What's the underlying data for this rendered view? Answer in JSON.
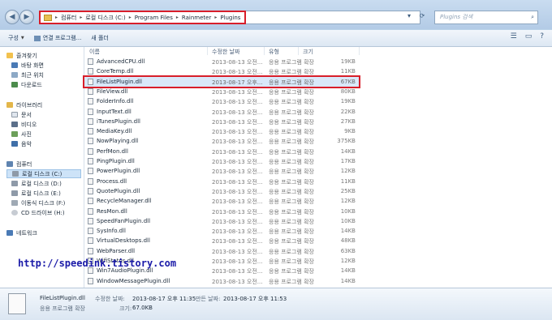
{
  "address": {
    "crumbs": [
      "컴퓨터",
      "로컬 디스크 (C:)",
      "Program Files",
      "Rainmeter",
      "Plugins"
    ],
    "search_placeholder": "Plugins 검색"
  },
  "toolbar": {
    "organize": "구성",
    "open_program": "연결 프로그램...",
    "new_folder": "새 폴더"
  },
  "nav": {
    "favorites": "즐겨찾기",
    "desktop": "바탕 화면",
    "recent": "최근 위치",
    "downloads": "다운로드",
    "libraries": "라이브러리",
    "documents": "문서",
    "videos": "비디오",
    "pictures": "사진",
    "music": "음악",
    "computer": "컴퓨터",
    "drive_c": "로컬 디스크 (C:)",
    "drive_d": "로컬 디스크 (D:)",
    "drive_e": "로컬 디스크 (E:)",
    "drive_f": "이동식 디스크 (F:)",
    "drive_h": "CD 드라이브 (H:)",
    "network": "네트워크"
  },
  "columns": {
    "name": "이름",
    "date": "수정한 날짜",
    "type": "유형",
    "size": "크기"
  },
  "files": [
    {
      "name": "AdvancedCPU.dll",
      "date": "2013-08-13 오전...",
      "type": "응용 프로그램 확장",
      "size": "19KB"
    },
    {
      "name": "CoreTemp.dll",
      "date": "2013-08-13 오전...",
      "type": "응용 프로그램 확장",
      "size": "11KB"
    },
    {
      "name": "FileListPlugin.dll",
      "date": "2013-08-17 오후...",
      "type": "응용 프로그램 확장",
      "size": "67KB"
    },
    {
      "name": "FileView.dll",
      "date": "2013-08-13 오전...",
      "type": "응용 프로그램 확장",
      "size": "80KB"
    },
    {
      "name": "FolderInfo.dll",
      "date": "2013-08-13 오전...",
      "type": "응용 프로그램 확장",
      "size": "19KB"
    },
    {
      "name": "InputText.dll",
      "date": "2013-08-13 오전...",
      "type": "응용 프로그램 확장",
      "size": "22KB"
    },
    {
      "name": "iTunesPlugin.dll",
      "date": "2013-08-13 오전...",
      "type": "응용 프로그램 확장",
      "size": "27KB"
    },
    {
      "name": "MediaKey.dll",
      "date": "2013-08-13 오전...",
      "type": "응용 프로그램 확장",
      "size": "9KB"
    },
    {
      "name": "NowPlaying.dll",
      "date": "2013-08-13 오전...",
      "type": "응용 프로그램 확장",
      "size": "375KB"
    },
    {
      "name": "PerfMon.dll",
      "date": "2013-08-13 오전...",
      "type": "응용 프로그램 확장",
      "size": "14KB"
    },
    {
      "name": "PingPlugin.dll",
      "date": "2013-08-13 오전...",
      "type": "응용 프로그램 확장",
      "size": "17KB"
    },
    {
      "name": "PowerPlugin.dll",
      "date": "2013-08-13 오전...",
      "type": "응용 프로그램 확장",
      "size": "12KB"
    },
    {
      "name": "Process.dll",
      "date": "2013-08-13 오전...",
      "type": "응용 프로그램 확장",
      "size": "11KB"
    },
    {
      "name": "QuotePlugin.dll",
      "date": "2013-08-13 오전...",
      "type": "응용 프로그램 확장",
      "size": "25KB"
    },
    {
      "name": "RecycleManager.dll",
      "date": "2013-08-13 오전...",
      "type": "응용 프로그램 확장",
      "size": "12KB"
    },
    {
      "name": "ResMon.dll",
      "date": "2013-08-13 오전...",
      "type": "응용 프로그램 확장",
      "size": "10KB"
    },
    {
      "name": "SpeedFanPlugin.dll",
      "date": "2013-08-13 오전...",
      "type": "응용 프로그램 확장",
      "size": "10KB"
    },
    {
      "name": "SysInfo.dll",
      "date": "2013-08-13 오전...",
      "type": "응용 프로그램 확장",
      "size": "14KB"
    },
    {
      "name": "VirtualDesktops.dll",
      "date": "2013-08-13 오전...",
      "type": "응용 프로그램 확장",
      "size": "48KB"
    },
    {
      "name": "WebParser.dll",
      "date": "2013-08-13 오전...",
      "type": "응용 프로그램 확장",
      "size": "63KB"
    },
    {
      "name": "WifiStatus.dll",
      "date": "2013-08-13 오전...",
      "type": "응용 프로그램 확장",
      "size": "12KB"
    },
    {
      "name": "Win7AudioPlugin.dll",
      "date": "2013-08-13 오전...",
      "type": "응용 프로그램 확장",
      "size": "14KB"
    },
    {
      "name": "WindowMessagePlugin.dll",
      "date": "2013-08-13 오전...",
      "type": "응용 프로그램 확장",
      "size": "14KB"
    }
  ],
  "watermark": "http://speedink.tistory.com",
  "details": {
    "filename": "FileListPlugin.dll",
    "filetype": "응용 프로그램 확장",
    "modified_label": "수정한 날짜:",
    "modified_value": "2013-08-17 오후 11:35",
    "created_label": "만든 날짜:",
    "created_value": "2013-08-17 오후 11:53",
    "size_label": "크기:",
    "size_value": "67.0KB"
  },
  "colors": {
    "accent": "#d81e2a",
    "selection": "#d9e8f9"
  }
}
